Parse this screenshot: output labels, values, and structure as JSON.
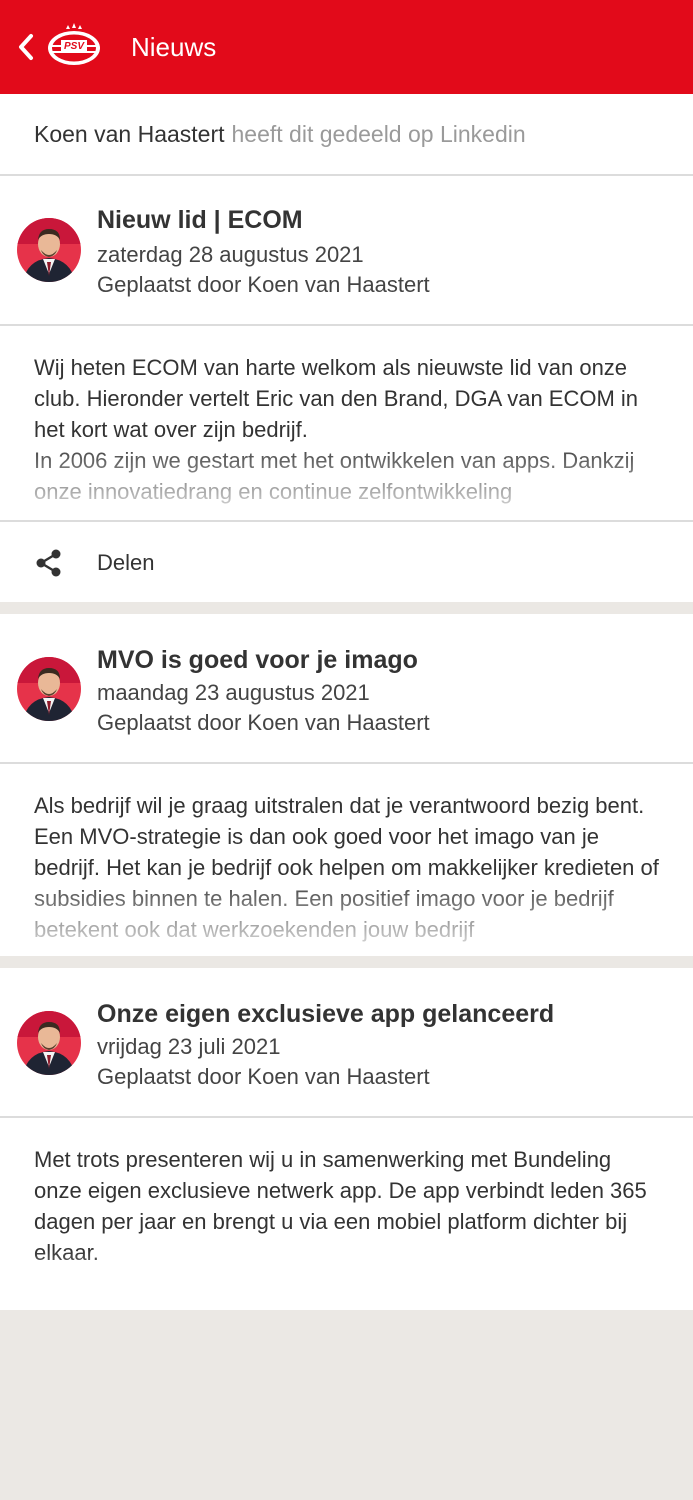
{
  "header": {
    "title": "Nieuws",
    "logo_text": "PSV"
  },
  "shared": {
    "who": "Koen van Haastert",
    "what": "heeft dit gedeeld op Linkedin"
  },
  "posts": [
    {
      "title": "Nieuw lid | ECOM",
      "date": "zaterdag 28 augustus 2021",
      "author": "Geplaatst door Koen van Haastert",
      "body": "Wij heten ECOM van harte welkom als nieuwste lid van onze club. Hieronder vertelt Eric van den Brand, DGA van ECOM in het kort wat over zijn bedrijf.\nIn 2006 zijn we gestart met het ontwikkelen van apps. Dankzij onze innovatiedrang en continue zelfontwikkeling",
      "share_label": "Delen"
    },
    {
      "title": "MVO is goed voor je imago",
      "date": "maandag 23 augustus 2021",
      "author": "Geplaatst door Koen van Haastert",
      "body": "Als bedrijf wil je graag uitstralen dat je verantwoord bezig bent. Een MVO-strategie is dan ook goed voor het imago van je bedrijf. Het kan je bedrijf ook helpen om makkelijker kredieten of subsidies binnen te halen. Een positief imago voor je bedrijf betekent ook dat werkzoekenden jouw bedrijf"
    },
    {
      "title": "Onze eigen exclusieve app gelanceerd",
      "date": "vrijdag 23 juli 2021",
      "author": "Geplaatst door Koen van Haastert",
      "body": "Met trots presenteren wij u in samenwerking met Bundeling onze eigen exclusieve netwerk app. De app verbindt leden 365 dagen per jaar en brengt u via een mobiel platform dichter bij elkaar."
    }
  ],
  "colors": {
    "brand": "#e20a1a",
    "background": "#ebe8e4"
  },
  "icons": {
    "back": "chevron-left-icon",
    "share": "share-icon",
    "avatar": "person-avatar"
  }
}
